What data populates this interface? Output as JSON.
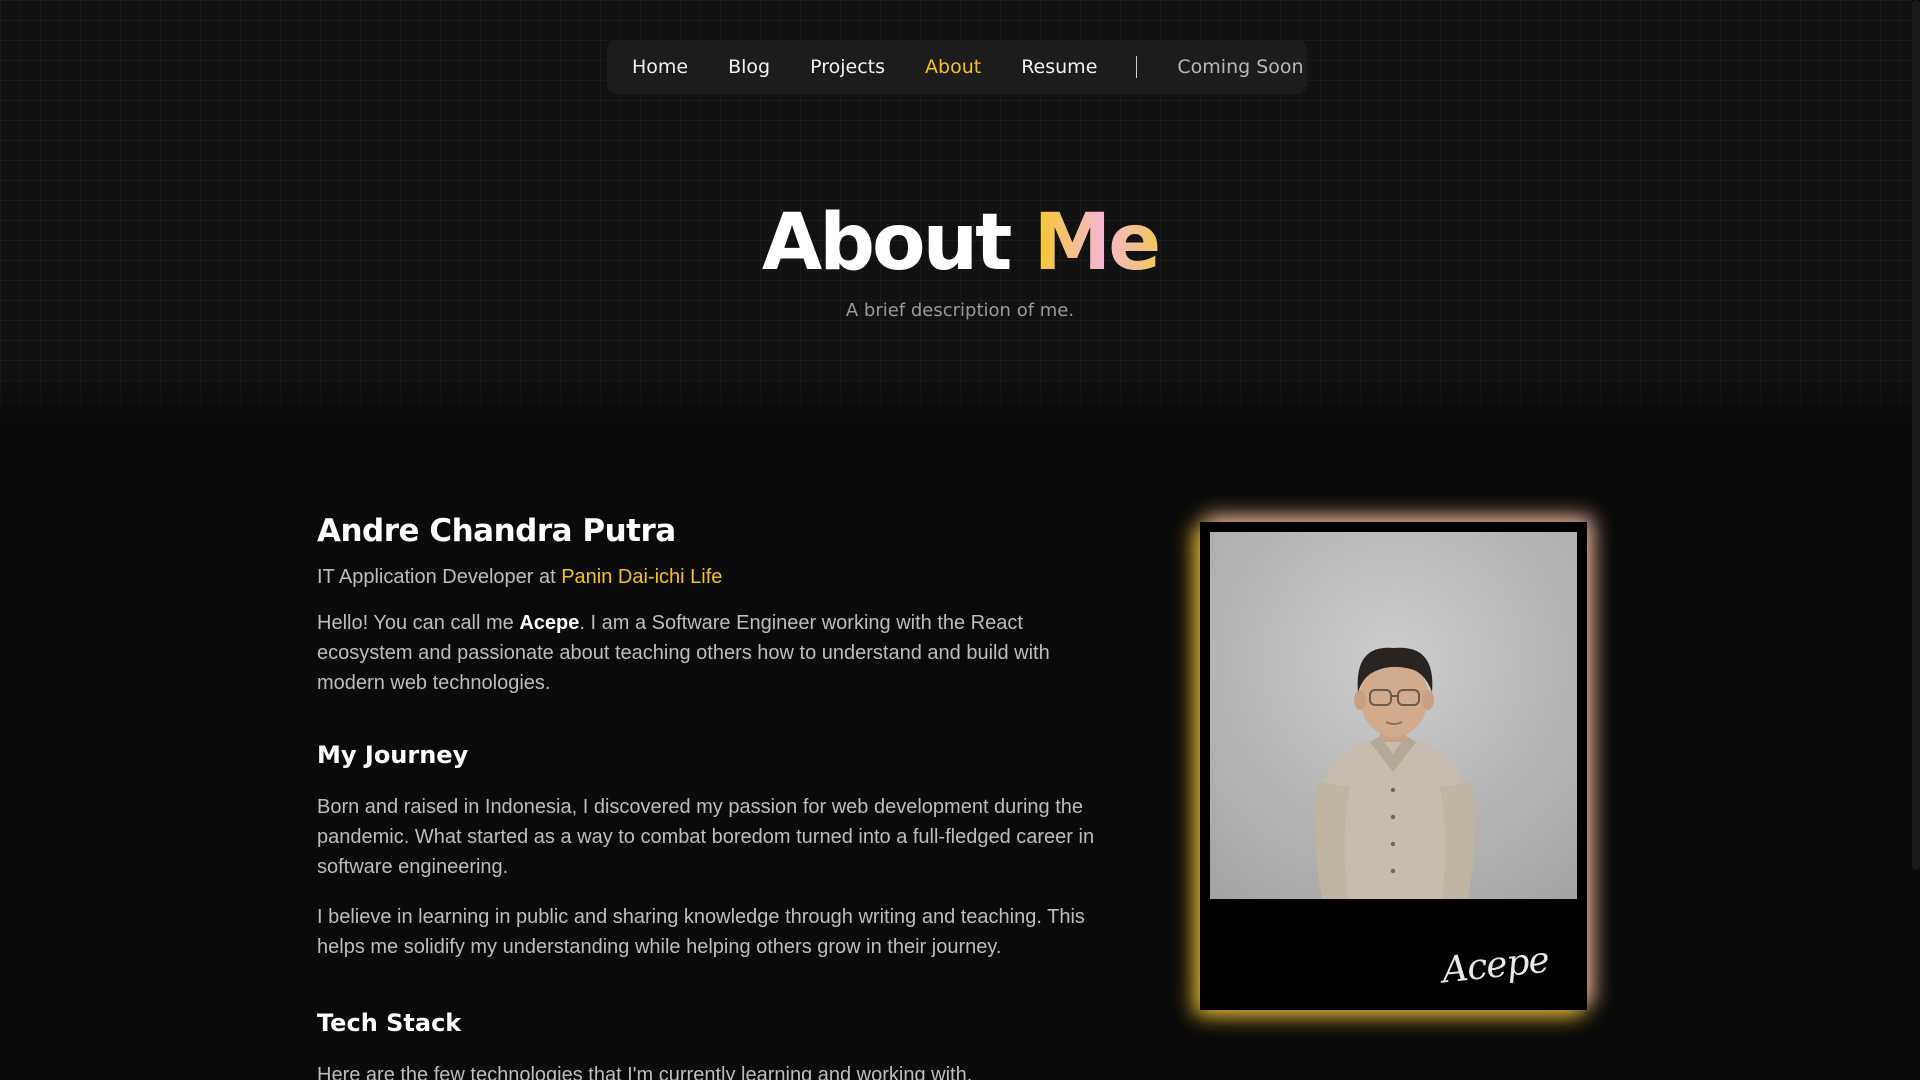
{
  "nav": {
    "items": [
      {
        "label": "Home",
        "active": false
      },
      {
        "label": "Blog",
        "active": false
      },
      {
        "label": "Projects",
        "active": false
      },
      {
        "label": "About",
        "active": true
      },
      {
        "label": "Resume",
        "active": false
      }
    ],
    "coming_soon": "Coming Soon"
  },
  "hero": {
    "title_main": "About ",
    "title_accent": "Me",
    "subtitle": "A brief description of me."
  },
  "profile": {
    "name": "Andre Chandra Putra",
    "role_prefix": "IT Application Developer at ",
    "company": "Panin Dai-ichi Life",
    "intro_prefix": "Hello! You can call me ",
    "nickname": "Acepe",
    "intro_suffix": ". I am a Software Engineer working with the React ecosystem and passionate about teaching others how to understand and build with modern web technologies."
  },
  "journey": {
    "heading": "My Journey",
    "p1": "Born and raised in Indonesia, I discovered my passion for web development during the pandemic. What started as a way to combat boredom turned into a full-fledged career in software engineering.",
    "p2": "I believe in learning in public and sharing knowledge through writing and teaching. This helps me solidify my understanding while helping others grow in their journey."
  },
  "tech": {
    "heading": "Tech Stack",
    "intro": "Here are the few technologies that I'm currently learning and working with."
  },
  "card": {
    "signature": "Acepe"
  },
  "colors": {
    "accent": "#f4c320",
    "accent_pink": "#f5b8d2",
    "background": "#0a0a0a"
  }
}
